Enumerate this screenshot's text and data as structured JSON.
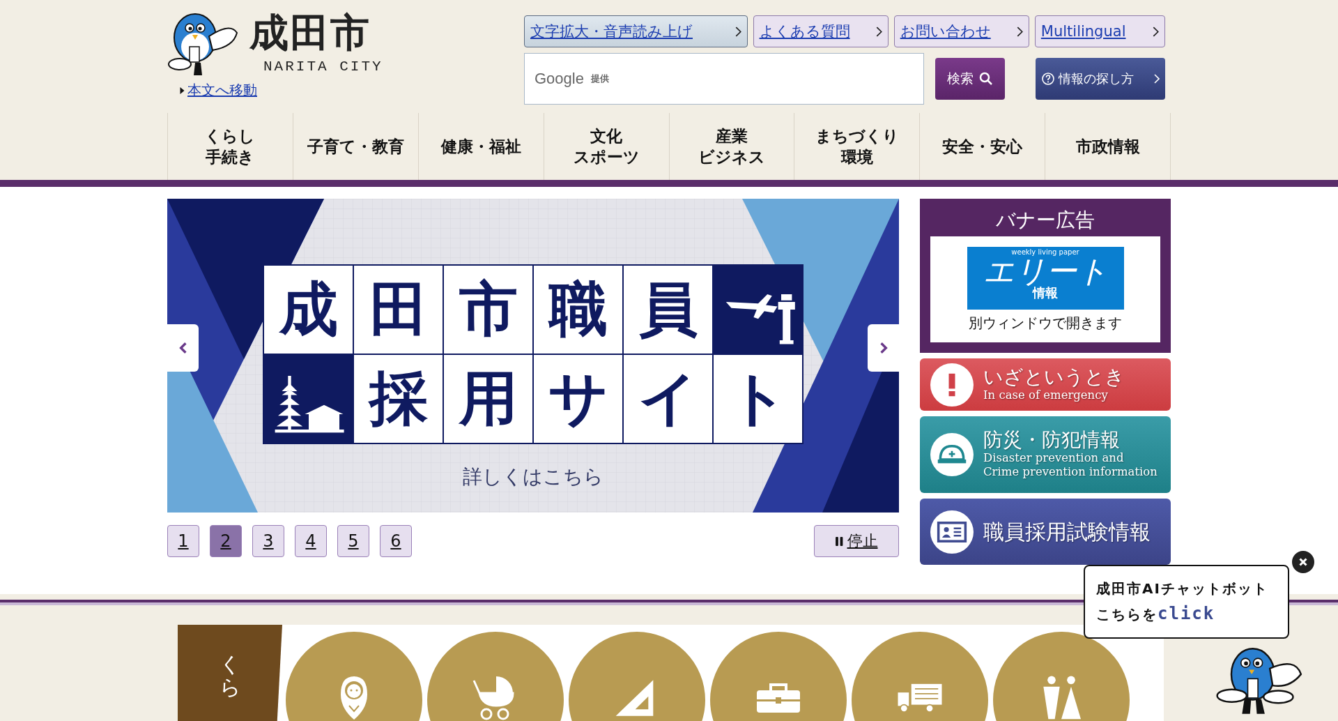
{
  "header": {
    "logo_title": "成田市",
    "logo_subtitle": "NARITA CITY",
    "skip_link": "本文へ移動"
  },
  "top_links": [
    {
      "label": "文字拡大・音声読み上げ",
      "highlighted": true
    },
    {
      "label": "よくある質問",
      "highlighted": false
    },
    {
      "label": "お問い合わせ",
      "highlighted": false
    },
    {
      "label": "Multilingual",
      "highlighted": false
    }
  ],
  "search": {
    "provider": "Google",
    "provider_note": "提供",
    "button": "検索"
  },
  "guide_button": "情報の探し方",
  "nav": [
    {
      "lines": [
        "くらし",
        "手続き"
      ]
    },
    {
      "lines": [
        "子育て・教育"
      ]
    },
    {
      "lines": [
        "健康・福祉"
      ]
    },
    {
      "lines": [
        "文化",
        "スポーツ"
      ]
    },
    {
      "lines": [
        "産業",
        "ビジネス"
      ]
    },
    {
      "lines": [
        "まちづくり",
        "環境"
      ]
    },
    {
      "lines": [
        "安全・安心"
      ]
    },
    {
      "lines": [
        "市政情報"
      ]
    }
  ],
  "banner": {
    "tiles_top": [
      "成",
      "田",
      "市",
      "職",
      "員"
    ],
    "tiles_bottom": [
      "採",
      "用",
      "サ",
      "イ",
      "ト"
    ],
    "caption": "詳しくはこちら"
  },
  "pager": [
    {
      "label": "1",
      "selected": false
    },
    {
      "label": "2",
      "selected": true
    },
    {
      "label": "3",
      "selected": false
    },
    {
      "label": "4",
      "selected": false
    },
    {
      "label": "5",
      "selected": false
    },
    {
      "label": "6",
      "selected": false
    }
  ],
  "pause_button": "停止",
  "ad": {
    "heading": "バナー広告",
    "ad_small": "weekly living paper",
    "ad_title": "エリート",
    "ad_sub": "情報",
    "note": "別ウィンドウで開きます"
  },
  "quick_links": [
    {
      "kind": "emergency",
      "title": "いざというとき",
      "subtitle": [
        "In case of emergency"
      ]
    },
    {
      "kind": "disaster",
      "title": "防災・防犯情報",
      "subtitle": [
        "Disaster prevention and",
        "Crime prevention information"
      ]
    },
    {
      "kind": "recruit",
      "title": "職員採用試験情報"
    }
  ],
  "category": {
    "heading": "くら"
  },
  "chatbot": {
    "line1": "成田市AIチャットボット",
    "line2_prefix": "こちらを",
    "line2_highlight": "click"
  }
}
